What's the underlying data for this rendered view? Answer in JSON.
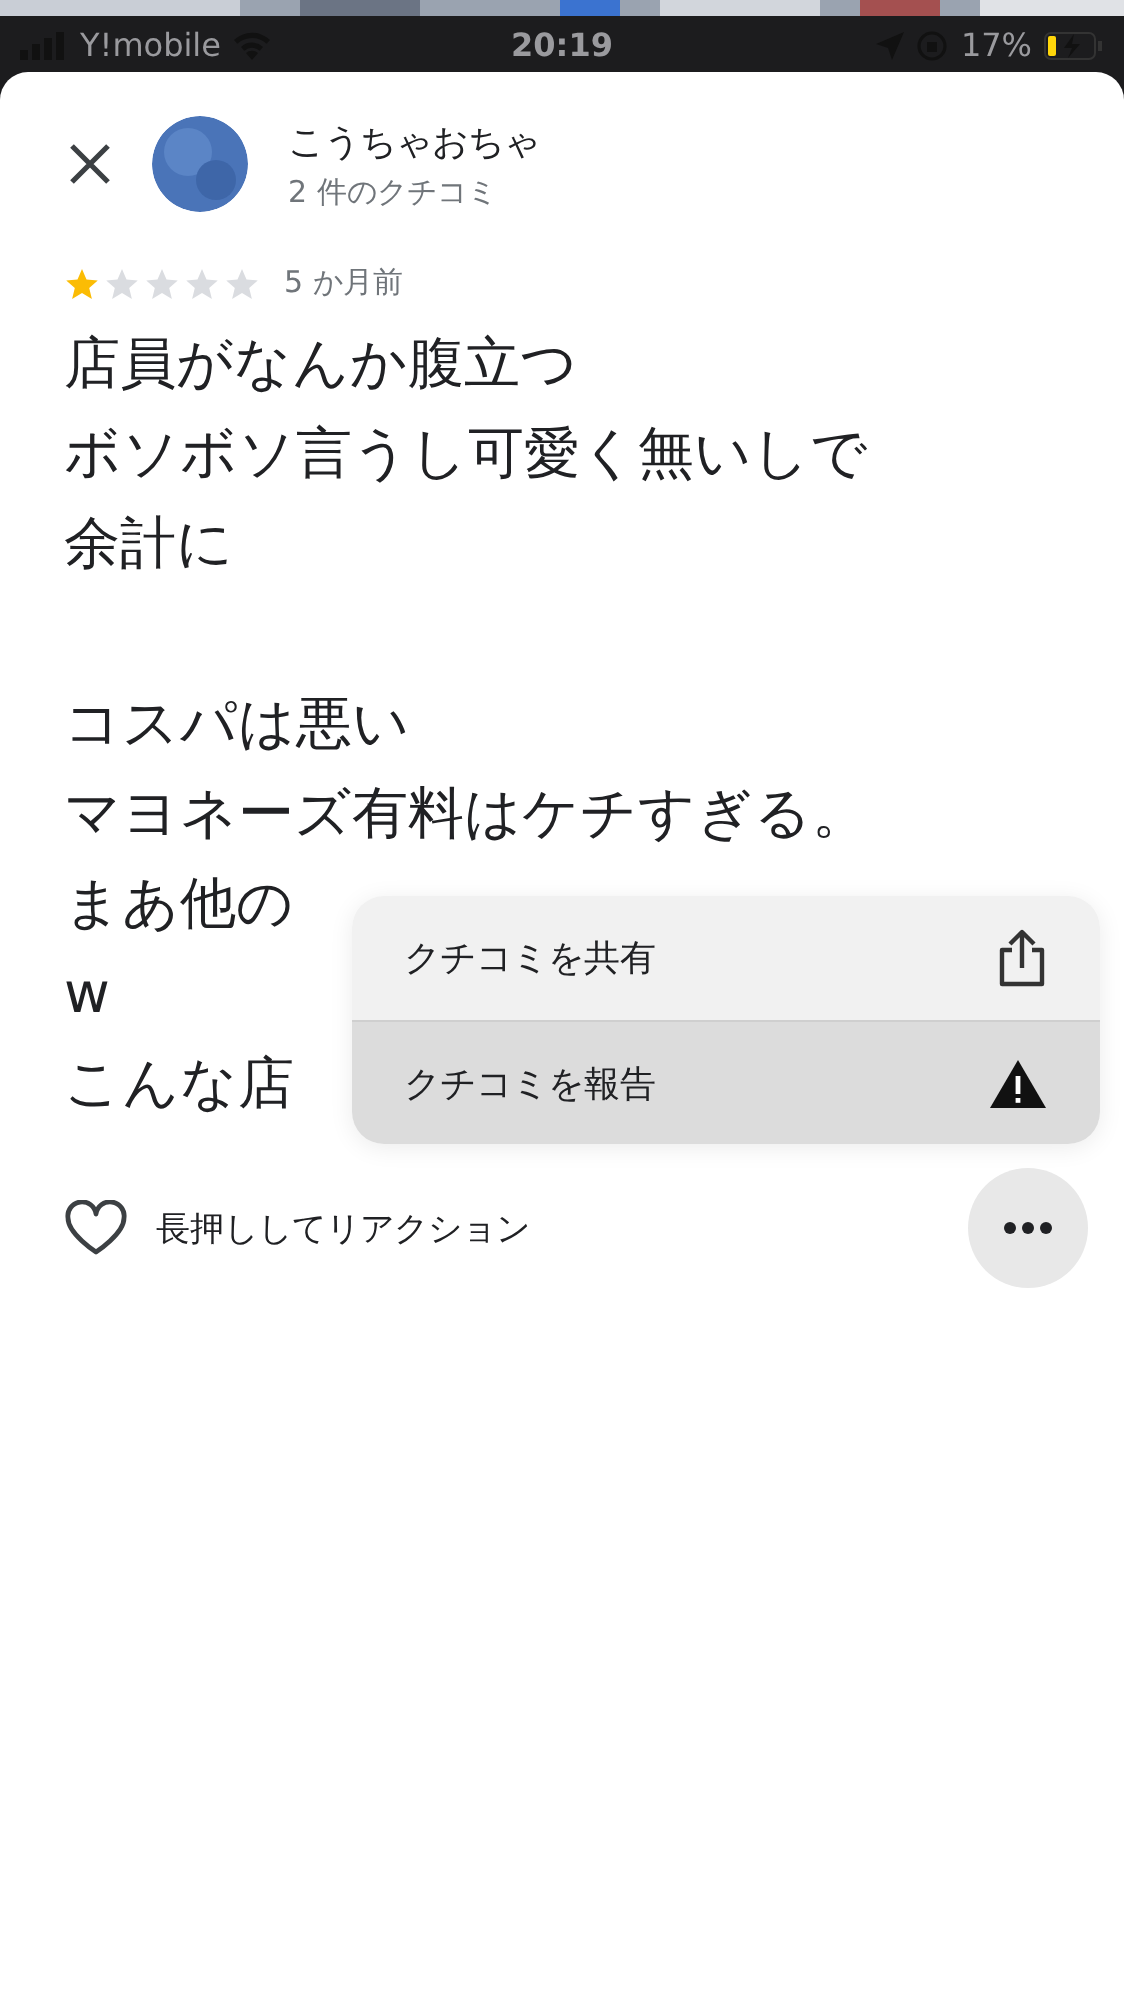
{
  "status_bar": {
    "carrier": "Y!mobile",
    "time": "20:19",
    "battery": "17%"
  },
  "reviewer": {
    "name": "こうちゃおちゃ",
    "review_count": "2 件のクチコミ"
  },
  "review": {
    "stars": 1,
    "age": "5 か月前",
    "paragraphs": [
      [
        "店員がなんか腹立つ",
        "ボソボソ言うし可愛く無いしで",
        "余計に"
      ],
      [
        "コスパは悪い",
        "マヨネーズ有料はケチすぎる。",
        "まあ他の",
        "w",
        "こんな店"
      ]
    ]
  },
  "reaction": {
    "label": "長押ししてリアクション"
  },
  "menu": [
    {
      "kind": "share",
      "label": "クチコミを共有",
      "selected": false
    },
    {
      "kind": "report",
      "label": "クチコミを報告",
      "selected": true
    }
  ]
}
